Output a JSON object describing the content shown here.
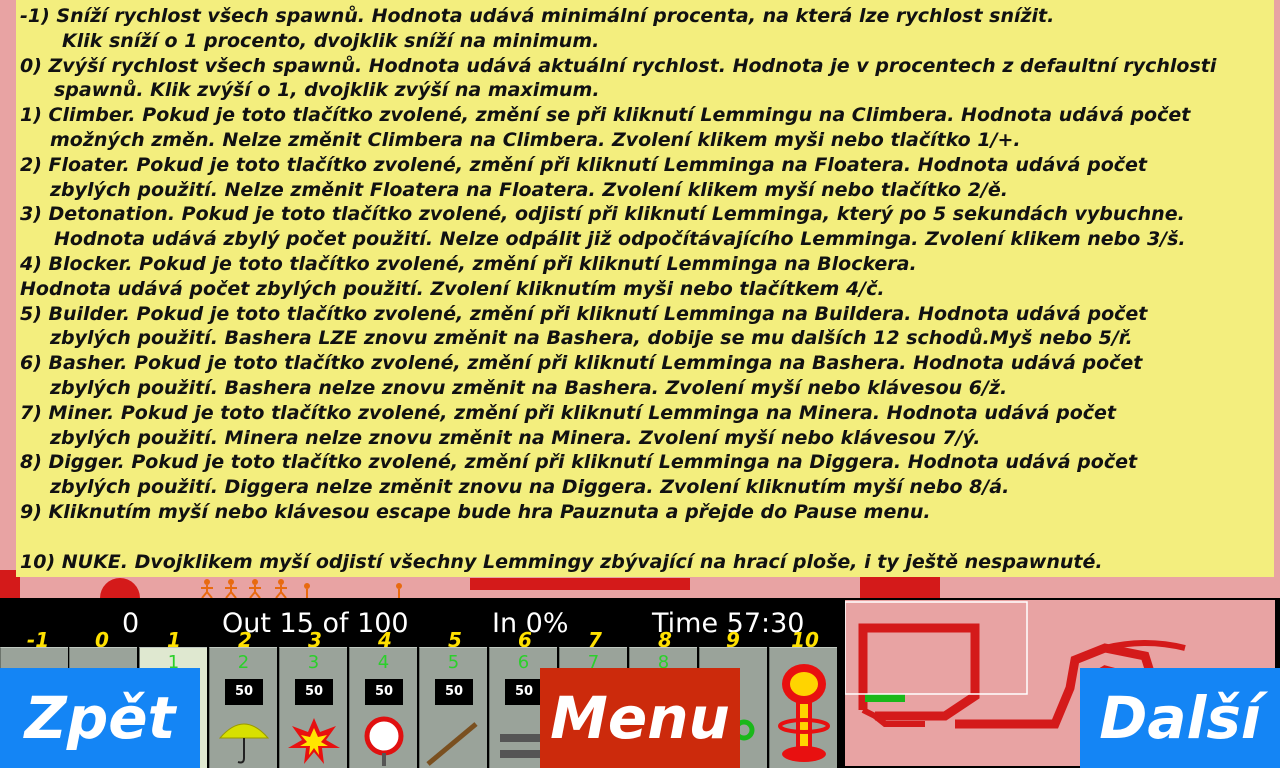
{
  "help": {
    "lines": [
      "-1) Sníží rychlost všech spawnů. Hodnota udává minimální procenta, na která lze rychlost snížit.",
      "Klik sníží o 1 procento, dvojklik sníží na minimum.",
      "0) Zvýší rychlost všech spawnů. Hodnota udává aktuální rychlost. Hodnota je v procentech z defaultní rychlosti",
      "spawnů. Klik zvýší o 1, dvojklik zvýší na maximum.",
      "1) Climber. Pokud je toto tlačítko zvolené, změní se při kliknutí Lemmingu na Climbera. Hodnota udává počet",
      "možných změn. Nelze změnit Climbera na Climbera. Zvolení klikem myši nebo tlačítko 1/+.",
      "2) Floater. Pokud je toto tlačítko zvolené, změní při kliknutí Lemminga na Floatera. Hodnota udává počet",
      "zbylých použití. Nelze změnit Floatera na Floatera. Zvolení klikem myší nebo tlačítko 2/ě.",
      "3) Detonation. Pokud je toto tlačítko zvolené, odjistí při kliknutí Lemminga, který po 5 sekundách vybuchne.",
      "Hodnota udává zbylý počet použití. Nelze odpálit již odpočítávajícího Lemminga. Zvolení klikem nebo 3/š.",
      "4) Blocker. Pokud je toto tlačítko zvolené, změní při kliknutí Lemminga na Blockera.",
      "Hodnota udává počet zbylých použití. Zvolení kliknutím myši nebo tlačítkem 4/č.",
      "5) Builder. Pokud je toto tlačítko zvolené, změní při kliknutí Lemminga na Buildera. Hodnota udává počet",
      "zbylých použití. Bashera LZE znovu změnit na Bashera, dobije se mu dalších 12 schodů.Myš nebo 5/ř.",
      "6) Basher. Pokud je toto tlačítko zvolené, změní při kliknutí Lemminga na Bashera. Hodnota udává počet",
      "zbylých použití. Bashera nelze znovu změnit na Bashera. Zvolení myší nebo klávesou 6/ž.",
      "7) Miner. Pokud je toto tlačítko zvolené, změní při kliknutí Lemminga na Minera. Hodnota udává počet",
      "zbylých použití. Minera nelze znovu změnit na Minera. Zvolení myší nebo klávesou 7/ý.",
      "8) Digger. Pokud je toto tlačítko zvolené, změní při kliknutí Lemminga na Diggera. Hodnota udává počet",
      "zbylých použití. Diggera nelze změnit znovu na Diggera. Zvolení kliknutím myší nebo 8/á.",
      "9) Kliknutím myší nebo klávesou escape bude hra Pauznuta a přejde do Pause menu.",
      "10) NUKE. Dvojklikem myší odjistí všechny Lemmingy zbývající na hrací ploše, i ty ještě nespawnuté."
    ]
  },
  "hud": {
    "release_rate": "0",
    "out": "Out 15 of 100",
    "in": "In 0%",
    "time": "Time 57:30"
  },
  "button_numbers": [
    "-1",
    "0",
    "1",
    "2",
    "3",
    "4",
    "5",
    "6",
    "7",
    "8",
    "9",
    "10"
  ],
  "buttons": [
    {
      "name": "release-rate-minus",
      "level": "",
      "count": ""
    },
    {
      "name": "release-rate-plus",
      "level": "",
      "count": ""
    },
    {
      "name": "climber",
      "level": "1",
      "count": ""
    },
    {
      "name": "floater",
      "level": "2",
      "count": "50",
      "icon": "umbrella-icon"
    },
    {
      "name": "bomber",
      "level": "3",
      "count": "50",
      "icon": "explosion-icon"
    },
    {
      "name": "blocker",
      "level": "4",
      "count": "50",
      "icon": "stop-sign-icon"
    },
    {
      "name": "builder",
      "level": "5",
      "count": "50",
      "icon": "stairs-icon"
    },
    {
      "name": "basher",
      "level": "6",
      "count": "50",
      "icon": "basher-icon"
    },
    {
      "name": "miner",
      "level": "7",
      "count": ""
    },
    {
      "name": "digger",
      "level": "8",
      "count": ""
    },
    {
      "name": "pause",
      "level": "",
      "count": ""
    },
    {
      "name": "nuke",
      "level": "",
      "count": "",
      "icon": "mushroom-cloud-icon"
    }
  ],
  "nav": {
    "back": "Zpět",
    "menu": "Menu",
    "next": "Další"
  },
  "colors": {
    "help_bg": "#f3ee7e",
    "nav_blue": "#1485f5",
    "nav_red": "#cc2a0c",
    "level_green": "#2bd02b",
    "number_yellow": "#ffe100"
  }
}
